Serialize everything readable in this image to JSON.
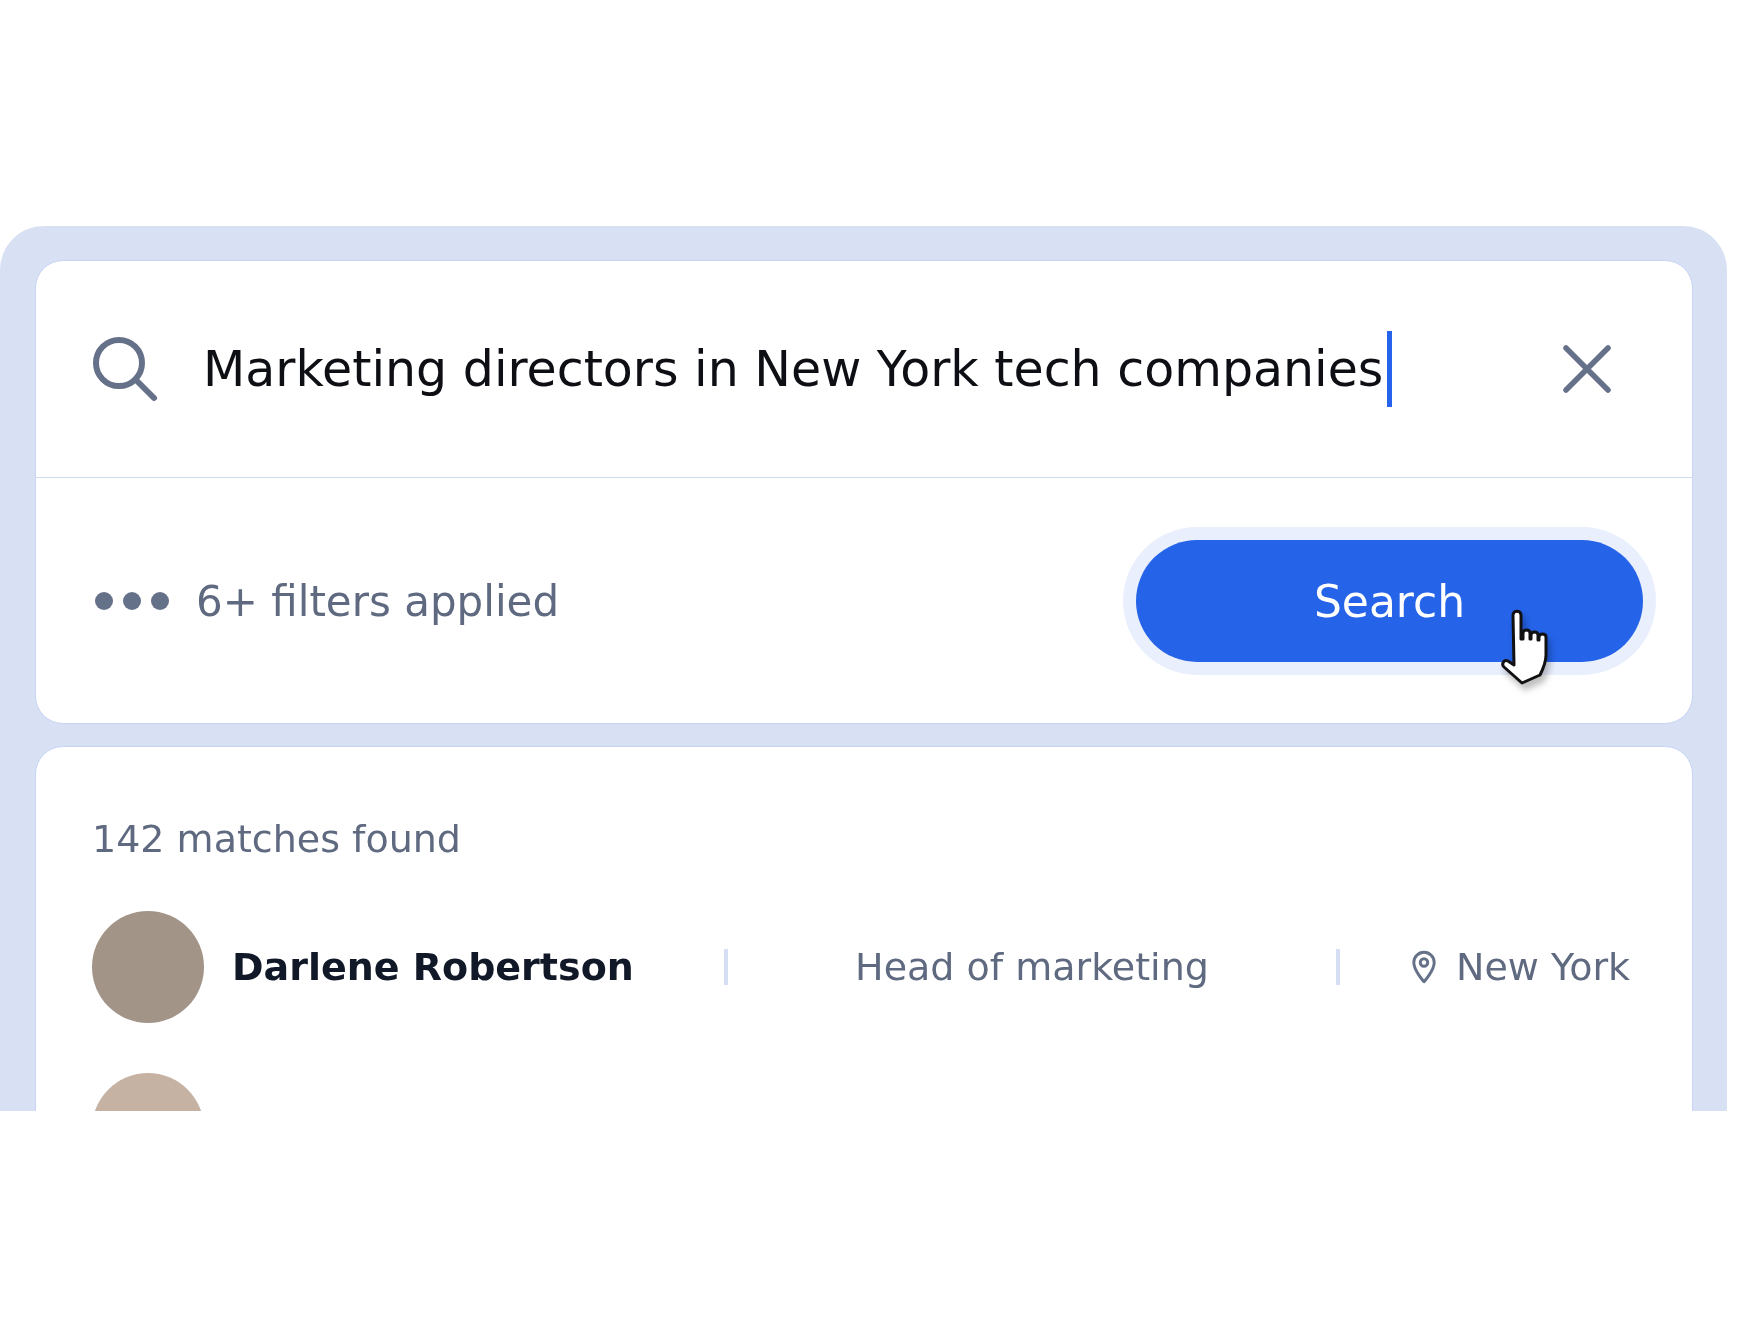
{
  "search": {
    "query": "Marketing directors in New York tech companies"
  },
  "filters": {
    "label": "6+ filters applied"
  },
  "search_button": {
    "label": "Search"
  },
  "results": {
    "count_label": "142 matches found",
    "rows": [
      {
        "name": "Darlene Robertson",
        "title": "Head of marketing",
        "location": "New York"
      }
    ]
  }
}
